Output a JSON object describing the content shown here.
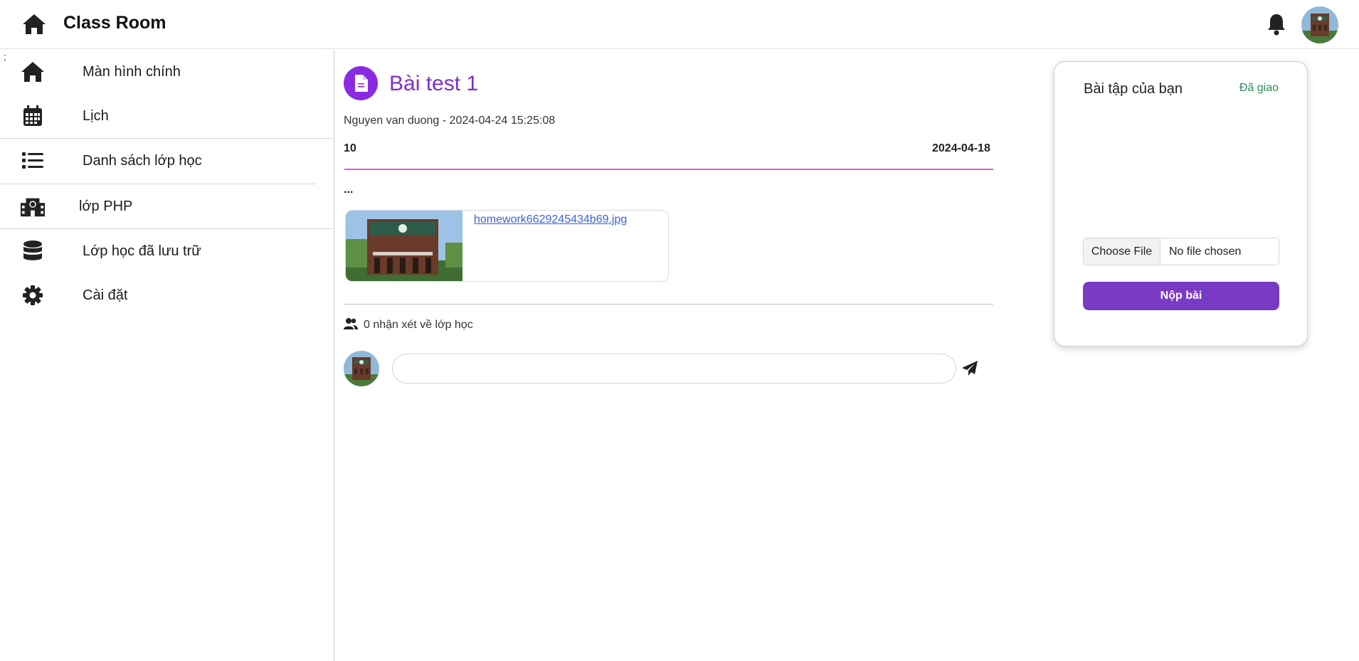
{
  "header": {
    "title": "Class Room",
    "home_icon": "home-icon",
    "bell_icon": "bell-icon"
  },
  "stray_text": ";",
  "sidebar": {
    "items": [
      {
        "label": "Màn hình chính",
        "icon": "home-icon"
      },
      {
        "label": "Lịch",
        "icon": "calendar-icon"
      },
      {
        "label": "Danh sách lớp học",
        "icon": "list-icon"
      },
      {
        "label": "lớp PHP",
        "icon": "school-icon"
      },
      {
        "label": "Lớp học đã lưu trữ",
        "icon": "database-icon"
      },
      {
        "label": "Cài đặt",
        "icon": "gear-icon"
      }
    ]
  },
  "post": {
    "title": "Bài test 1",
    "meta": "Nguyen van duong - 2024-04-24 15:25:08",
    "points": "10",
    "due_date": "2024-04-18",
    "body": "...",
    "attachment": {
      "filename": "homework6629245434b69.jpg"
    }
  },
  "comments": {
    "count_label": "0 nhận xét về lớp học",
    "input_value": "",
    "input_placeholder": ""
  },
  "submission_card": {
    "title": "Bài tập của bạn",
    "status": "Đã giao",
    "choose_file_label": "Choose File",
    "no_file_label": "No file chosen",
    "submit_label": "Nộp bài"
  },
  "colors": {
    "accent_purple": "#7e2fc9",
    "icon_purple": "#8a2be2",
    "submit_purple": "#7a3bc4",
    "divider_pink": "#d760d0",
    "status_green": "#2e8b57",
    "link_blue": "#3b63d6"
  }
}
